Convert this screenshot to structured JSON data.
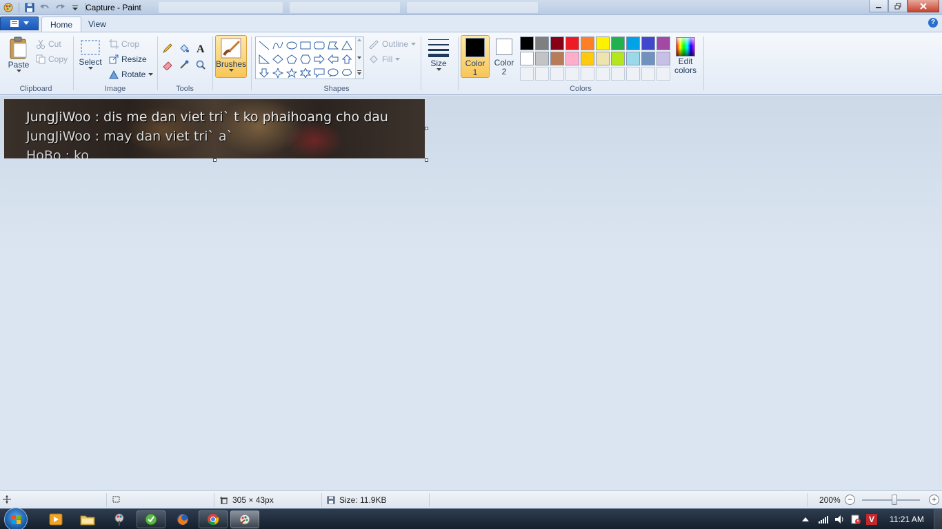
{
  "window": {
    "title": "Capture - Paint"
  },
  "tabs": {
    "home": "Home",
    "view": "View"
  },
  "help_label": "?",
  "clipboard": {
    "paste": "Paste",
    "cut": "Cut",
    "copy": "Copy",
    "label": "Clipboard"
  },
  "image_group": {
    "select": "Select",
    "crop": "Crop",
    "resize": "Resize",
    "rotate": "Rotate",
    "label": "Image"
  },
  "tools": {
    "label": "Tools",
    "items": [
      "pencil-icon",
      "fill-icon",
      "text-icon",
      "eraser-icon",
      "color-picker-icon",
      "magnifier-icon"
    ]
  },
  "brushes": {
    "label": "Brushes"
  },
  "shapes": {
    "label": "Shapes",
    "outline": "Outline",
    "fill": "Fill"
  },
  "size": {
    "label": "Size"
  },
  "colors": {
    "label": "Colors",
    "color1_line1": "Color",
    "color1_line2": "1",
    "color2_line1": "Color",
    "color2_line2": "2",
    "color1": "#000000",
    "color2": "#ffffff",
    "edit_line1": "Edit",
    "edit_line2": "colors",
    "palette_row1": [
      "#000000",
      "#7f7f7f",
      "#880015",
      "#ed1c24",
      "#ff7f27",
      "#fff200",
      "#22b14c",
      "#00a2e8",
      "#3f48cc",
      "#a349a4"
    ],
    "palette_row2": [
      "#ffffff",
      "#c3c3c3",
      "#b97a57",
      "#ffaec9",
      "#ffc90e",
      "#efe4b0",
      "#b5e61d",
      "#99d9ea",
      "#7092be",
      "#c8bfe7"
    ]
  },
  "canvas_image": {
    "lines": [
      "JungJiWoo : dis me dan viet tri` t ko phaihoang cho dau",
      "JungJiWoo : may dan viet tri` a`",
      "HoBo : ko"
    ]
  },
  "status": {
    "dimensions": "305 × 43px",
    "size": "Size: 11.9KB",
    "zoom": "200%",
    "zoom_minus": "−",
    "zoom_plus": "+"
  },
  "taskbar": {
    "apps": [
      "media-player-icon",
      "explorer-icon",
      "paint-pinned-icon",
      "green-app-icon",
      "firefox-icon",
      "chrome-icon",
      "paint-icon"
    ],
    "clock": "11:21 AM",
    "tray_badge": "V"
  }
}
